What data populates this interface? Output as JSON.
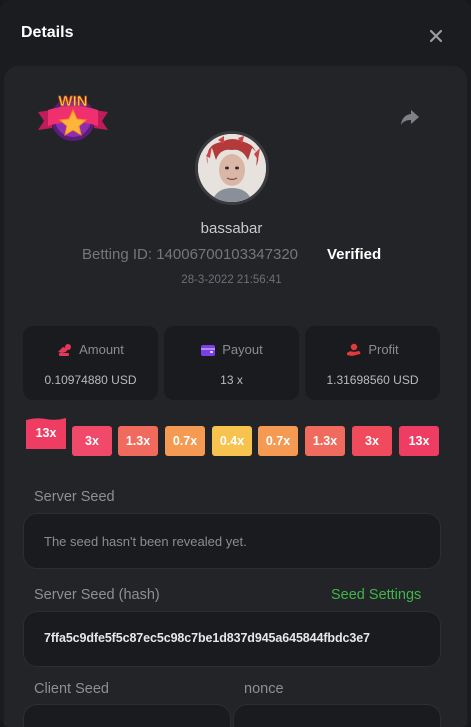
{
  "header": {
    "title": "Details",
    "close_icon": "close-icon"
  },
  "bet": {
    "badge_text": "WIN",
    "username": "bassabar",
    "betting_id_label": "Betting ID: ",
    "betting_id": "14006700103347320",
    "verified": "Verified",
    "datetime": "28-3-2022 21:56:41"
  },
  "stats": [
    {
      "label": "Amount",
      "value": "0.10974880 USD",
      "icon": "amount-icon",
      "color": "#e2385b"
    },
    {
      "label": "Payout",
      "value": "13 x",
      "icon": "wallet-icon",
      "color": "#7b3fe4"
    },
    {
      "label": "Profit",
      "value": "1.31698560 USD",
      "icon": "profit-icon",
      "color": "#e23a3a"
    }
  ],
  "multipliers": {
    "active": "13x",
    "slots": [
      "3x",
      "1.3x",
      "0.7x",
      "0.4x",
      "0.7x",
      "1.3x",
      "3x",
      "13x"
    ],
    "colors": [
      "#f0496a",
      "#f06a5d",
      "#f49a52",
      "#f7c24e",
      "#f49a52",
      "#f06a5d",
      "#f04b5d",
      "#ef3c63"
    ]
  },
  "server_seed": {
    "label": "Server Seed",
    "value": "The seed hasn't been revealed yet."
  },
  "server_seed_hash": {
    "label": "Server Seed (hash)",
    "settings_label": "Seed Settings",
    "value": "7ffa5c9dfe5f5c87ec5c98c7be1d837d945a645844fbdc3e7"
  },
  "client_seed": {
    "label": "Client Seed"
  },
  "nonce": {
    "label": "nonce"
  }
}
